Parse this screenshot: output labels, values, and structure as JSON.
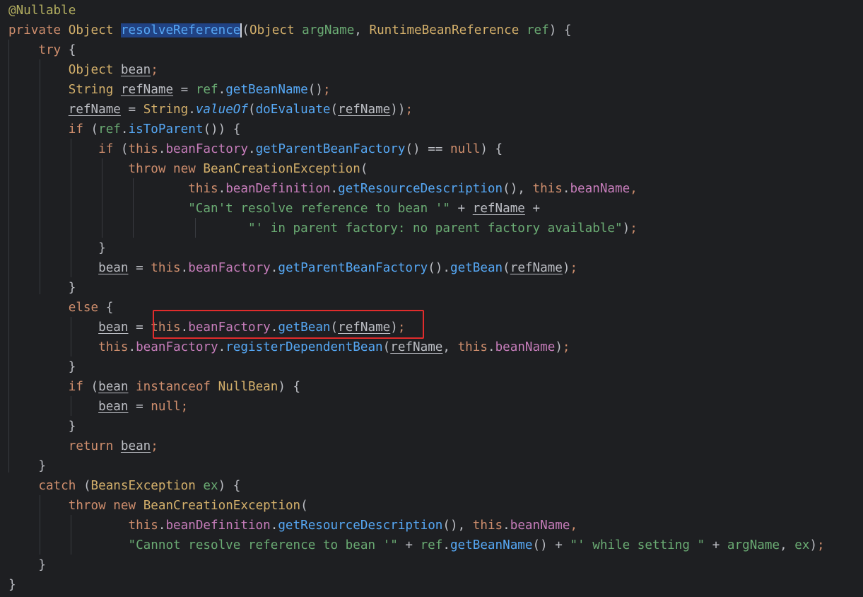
{
  "code": {
    "lines": [
      [
        {
          "t": "@Nullable",
          "c": "an"
        }
      ],
      [
        {
          "t": "private ",
          "c": "kw"
        },
        {
          "t": "Object ",
          "c": "typ"
        },
        {
          "t": "resolveReference",
          "c": "mtd sel"
        },
        {
          "t": "(",
          "c": "par"
        },
        {
          "t": "Object ",
          "c": "typ"
        },
        {
          "t": "argName",
          "c": "str"
        },
        {
          "t": ", ",
          "c": "par"
        },
        {
          "t": "RuntimeBeanReference ",
          "c": "typ"
        },
        {
          "t": "ref",
          "c": "str"
        },
        {
          "t": ") {",
          "c": "par"
        }
      ],
      [
        {
          "t": "    "
        },
        {
          "t": "try ",
          "c": "kw"
        },
        {
          "t": "{",
          "c": "par"
        }
      ],
      [
        {
          "t": "        "
        },
        {
          "t": "Object ",
          "c": "typ"
        },
        {
          "t": "bean",
          "c": "par u"
        },
        {
          "t": ";",
          "c": "semi"
        }
      ],
      [
        {
          "t": "        "
        },
        {
          "t": "String ",
          "c": "typ"
        },
        {
          "t": "refName",
          "c": "par u"
        },
        {
          "t": " = ",
          "c": "par"
        },
        {
          "t": "ref",
          "c": "str"
        },
        {
          "t": ".",
          "c": "par"
        },
        {
          "t": "getBeanName",
          "c": "mtd"
        },
        {
          "t": "()",
          "c": "par"
        },
        {
          "t": ";",
          "c": "semi"
        }
      ],
      [
        {
          "t": "        "
        },
        {
          "t": "refName",
          "c": "par u"
        },
        {
          "t": " = ",
          "c": "par"
        },
        {
          "t": "String",
          "c": "typ"
        },
        {
          "t": ".",
          "c": "par"
        },
        {
          "t": "valueOf",
          "c": "mtd it"
        },
        {
          "t": "(",
          "c": "par"
        },
        {
          "t": "doEvaluate",
          "c": "mtd"
        },
        {
          "t": "(",
          "c": "par"
        },
        {
          "t": "refName",
          "c": "par u"
        },
        {
          "t": "))",
          "c": "par"
        },
        {
          "t": ";",
          "c": "semi"
        }
      ],
      [
        {
          "t": "        "
        },
        {
          "t": "if ",
          "c": "kw"
        },
        {
          "t": "(",
          "c": "par"
        },
        {
          "t": "ref",
          "c": "str"
        },
        {
          "t": ".",
          "c": "par"
        },
        {
          "t": "isToParent",
          "c": "mtd"
        },
        {
          "t": "()) {",
          "c": "par"
        }
      ],
      [
        {
          "t": "            "
        },
        {
          "t": "if ",
          "c": "kw"
        },
        {
          "t": "(",
          "c": "par"
        },
        {
          "t": "this",
          "c": "this"
        },
        {
          "t": ".",
          "c": "par"
        },
        {
          "t": "beanFactory",
          "c": "fielduse"
        },
        {
          "t": ".",
          "c": "par"
        },
        {
          "t": "getParentBeanFactory",
          "c": "mtd"
        },
        {
          "t": "() == ",
          "c": "par"
        },
        {
          "t": "null",
          "c": "kw"
        },
        {
          "t": ") {",
          "c": "par"
        }
      ],
      [
        {
          "t": "                "
        },
        {
          "t": "throw new ",
          "c": "kw"
        },
        {
          "t": "BeanCreationException",
          "c": "typ"
        },
        {
          "t": "(",
          "c": "par"
        }
      ],
      [
        {
          "t": "                        "
        },
        {
          "t": "this",
          "c": "this"
        },
        {
          "t": ".",
          "c": "par"
        },
        {
          "t": "beanDefinition",
          "c": "fielduse"
        },
        {
          "t": ".",
          "c": "par"
        },
        {
          "t": "getResourceDescription",
          "c": "mtd"
        },
        {
          "t": "(), ",
          "c": "par"
        },
        {
          "t": "this",
          "c": "this"
        },
        {
          "t": ".",
          "c": "par"
        },
        {
          "t": "beanName",
          "c": "fielduse"
        },
        {
          "t": ",",
          "c": "semi"
        }
      ],
      [
        {
          "t": "                        "
        },
        {
          "t": "\"Can't resolve reference to bean '\"",
          "c": "str"
        },
        {
          "t": " + ",
          "c": "par"
        },
        {
          "t": "refName",
          "c": "par u"
        },
        {
          "t": " +",
          "c": "par"
        }
      ],
      [
        {
          "t": "                                "
        },
        {
          "t": "\"' in parent factory: no parent factory available\"",
          "c": "str"
        },
        {
          "t": ")",
          "c": "par"
        },
        {
          "t": ";",
          "c": "semi"
        }
      ],
      [
        {
          "t": "            "
        },
        {
          "t": "}",
          "c": "par"
        }
      ],
      [
        {
          "t": "            "
        },
        {
          "t": "bean",
          "c": "par u"
        },
        {
          "t": " = ",
          "c": "par"
        },
        {
          "t": "this",
          "c": "this"
        },
        {
          "t": ".",
          "c": "par"
        },
        {
          "t": "beanFactory",
          "c": "fielduse"
        },
        {
          "t": ".",
          "c": "par"
        },
        {
          "t": "getParentBeanFactory",
          "c": "mtd"
        },
        {
          "t": "().",
          "c": "par"
        },
        {
          "t": "getBean",
          "c": "mtd"
        },
        {
          "t": "(",
          "c": "par"
        },
        {
          "t": "refName",
          "c": "par u"
        },
        {
          "t": ")",
          "c": "par"
        },
        {
          "t": ";",
          "c": "semi"
        }
      ],
      [
        {
          "t": "        "
        },
        {
          "t": "}",
          "c": "par"
        }
      ],
      [
        {
          "t": "        "
        },
        {
          "t": "else ",
          "c": "kw"
        },
        {
          "t": "{",
          "c": "par"
        }
      ],
      [
        {
          "t": "            "
        },
        {
          "t": "bean",
          "c": "par u"
        },
        {
          "t": " = ",
          "c": "par"
        },
        {
          "t": "this",
          "c": "this"
        },
        {
          "t": ".",
          "c": "par"
        },
        {
          "t": "beanFactory",
          "c": "fielduse"
        },
        {
          "t": ".",
          "c": "par"
        },
        {
          "t": "getBean",
          "c": "mtd"
        },
        {
          "t": "(",
          "c": "par"
        },
        {
          "t": "refName",
          "c": "par u"
        },
        {
          "t": ")",
          "c": "par"
        },
        {
          "t": ";",
          "c": "semi"
        }
      ],
      [
        {
          "t": "            "
        },
        {
          "t": "this",
          "c": "this"
        },
        {
          "t": ".",
          "c": "par"
        },
        {
          "t": "beanFactory",
          "c": "fielduse"
        },
        {
          "t": ".",
          "c": "par"
        },
        {
          "t": "registerDependentBean",
          "c": "mtd"
        },
        {
          "t": "(",
          "c": "par"
        },
        {
          "t": "refName",
          "c": "par u"
        },
        {
          "t": ", ",
          "c": "par"
        },
        {
          "t": "this",
          "c": "this"
        },
        {
          "t": ".",
          "c": "par"
        },
        {
          "t": "beanName",
          "c": "fielduse"
        },
        {
          "t": ")",
          "c": "par"
        },
        {
          "t": ";",
          "c": "semi"
        }
      ],
      [
        {
          "t": "        "
        },
        {
          "t": "}",
          "c": "par"
        }
      ],
      [
        {
          "t": "        "
        },
        {
          "t": "if ",
          "c": "kw"
        },
        {
          "t": "(",
          "c": "par"
        },
        {
          "t": "bean",
          "c": "par u"
        },
        {
          "t": " ",
          "c": "par"
        },
        {
          "t": "instanceof ",
          "c": "kw"
        },
        {
          "t": "NullBean",
          "c": "typ"
        },
        {
          "t": ") {",
          "c": "par"
        }
      ],
      [
        {
          "t": "            "
        },
        {
          "t": "bean",
          "c": "par u"
        },
        {
          "t": " = ",
          "c": "par"
        },
        {
          "t": "null",
          "c": "kw"
        },
        {
          "t": ";",
          "c": "semi"
        }
      ],
      [
        {
          "t": "        "
        },
        {
          "t": "}",
          "c": "par"
        }
      ],
      [
        {
          "t": "        "
        },
        {
          "t": "return ",
          "c": "kw"
        },
        {
          "t": "bean",
          "c": "par u"
        },
        {
          "t": ";",
          "c": "semi"
        }
      ],
      [
        {
          "t": "    "
        },
        {
          "t": "}",
          "c": "par"
        }
      ],
      [
        {
          "t": "    "
        },
        {
          "t": "catch ",
          "c": "kw"
        },
        {
          "t": "(",
          "c": "par"
        },
        {
          "t": "BeansException ",
          "c": "typ"
        },
        {
          "t": "ex",
          "c": "str"
        },
        {
          "t": ") {",
          "c": "par"
        }
      ],
      [
        {
          "t": "        "
        },
        {
          "t": "throw new ",
          "c": "kw"
        },
        {
          "t": "BeanCreationException",
          "c": "typ"
        },
        {
          "t": "(",
          "c": "par"
        }
      ],
      [
        {
          "t": "                "
        },
        {
          "t": "this",
          "c": "this"
        },
        {
          "t": ".",
          "c": "par"
        },
        {
          "t": "beanDefinition",
          "c": "fielduse"
        },
        {
          "t": ".",
          "c": "par"
        },
        {
          "t": "getResourceDescription",
          "c": "mtd"
        },
        {
          "t": "(), ",
          "c": "par"
        },
        {
          "t": "this",
          "c": "this"
        },
        {
          "t": ".",
          "c": "par"
        },
        {
          "t": "beanName",
          "c": "fielduse"
        },
        {
          "t": ",",
          "c": "semi"
        }
      ],
      [
        {
          "t": "                "
        },
        {
          "t": "\"Cannot resolve reference to bean '\"",
          "c": "str"
        },
        {
          "t": " + ",
          "c": "par"
        },
        {
          "t": "ref",
          "c": "str"
        },
        {
          "t": ".",
          "c": "par"
        },
        {
          "t": "getBeanName",
          "c": "mtd"
        },
        {
          "t": "() + ",
          "c": "par"
        },
        {
          "t": "\"' while setting \"",
          "c": "str"
        },
        {
          "t": " + ",
          "c": "par"
        },
        {
          "t": "argName",
          "c": "str"
        },
        {
          "t": ", ",
          "c": "par"
        },
        {
          "t": "ex",
          "c": "str"
        },
        {
          "t": ")",
          "c": "par"
        },
        {
          "t": ";",
          "c": "semi"
        }
      ],
      [
        {
          "t": "    "
        },
        {
          "t": "}",
          "c": "par"
        }
      ],
      [
        {
          "t": "}",
          "c": "par"
        }
      ]
    ]
  },
  "colors": {
    "background": "#1e1f22",
    "keyword": "#cf8e6d",
    "annotation": "#b3ae60",
    "field": "#c77dbb",
    "method": "#56a8f5",
    "string": "#6aab73",
    "type": "#d4b06b",
    "plain": "#bcbec4",
    "highlight_box": "#e12c2c",
    "selection": "#214283"
  },
  "highlight": {
    "line_index": 16,
    "text": "this.beanFactory.getBean(refName);"
  }
}
